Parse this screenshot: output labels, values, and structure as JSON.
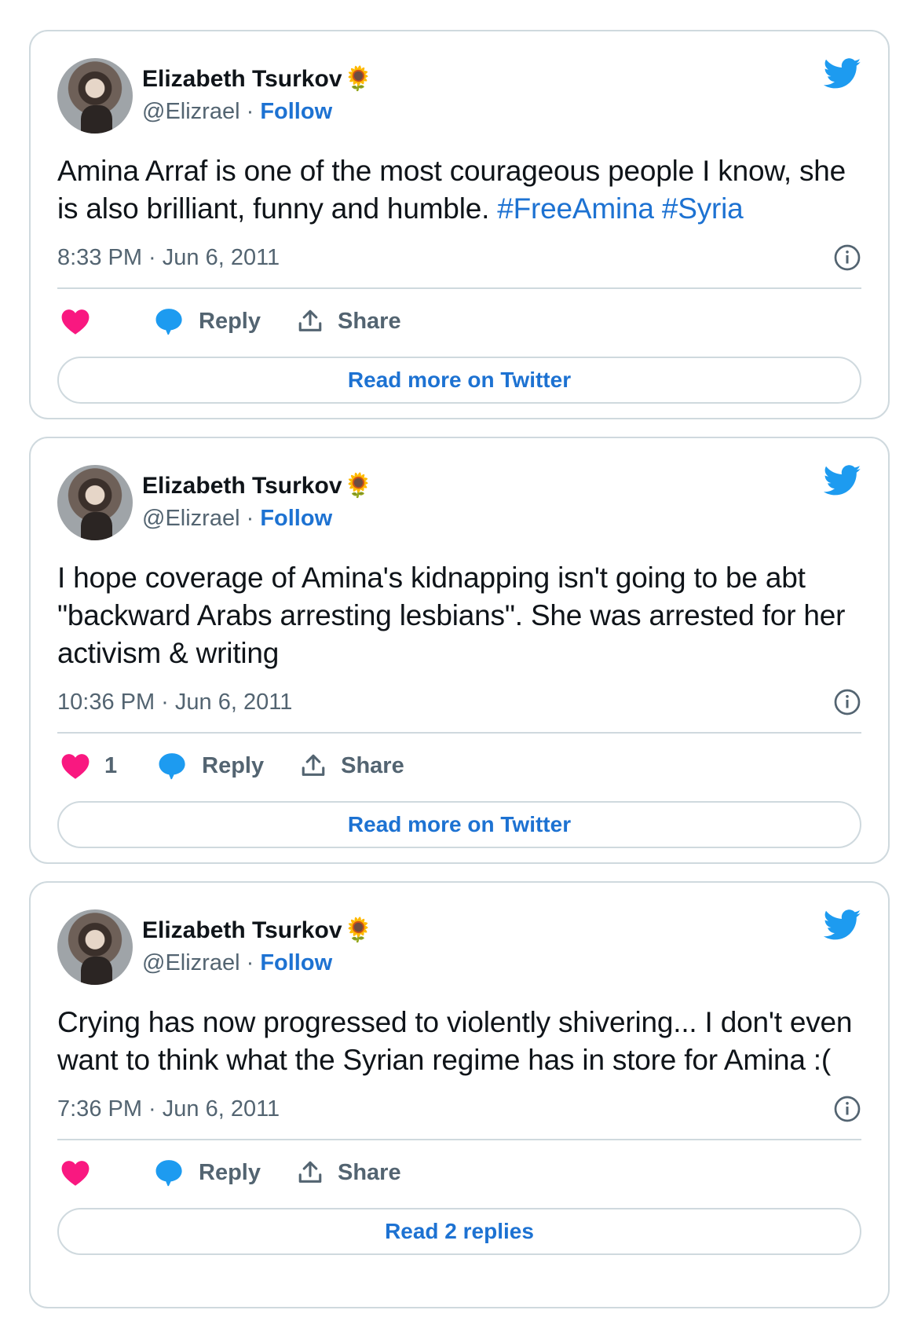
{
  "tweets": [
    {
      "author": {
        "name": "Elizabeth Tsurkov",
        "emoji": "🌻",
        "handle": "@Elizrael",
        "separator": " · ",
        "follow_label": "Follow"
      },
      "text": "Amina Arraf is one of the most courageous people I know, she is also brilliant, funny and humble. ",
      "hashtags": [
        "#FreeAmina",
        "#Syria"
      ],
      "timestamp": "8:33 PM · Jun 6, 2011",
      "likes": "",
      "reply_label": "Reply",
      "share_label": "Share",
      "cta_label": "Read more on Twitter"
    },
    {
      "author": {
        "name": "Elizabeth Tsurkov",
        "emoji": "🌻",
        "handle": "@Elizrael",
        "separator": " · ",
        "follow_label": "Follow"
      },
      "text": "I hope coverage of Amina's kidnapping isn't going to be abt \"backward Arabs arresting lesbians\". She was arrested for her activism & writing",
      "hashtags": [],
      "timestamp": "10:36 PM · Jun 6, 2011",
      "likes": "1",
      "reply_label": "Reply",
      "share_label": "Share",
      "cta_label": "Read more on Twitter"
    },
    {
      "author": {
        "name": "Elizabeth Tsurkov",
        "emoji": "🌻",
        "handle": "@Elizrael",
        "separator": " · ",
        "follow_label": "Follow"
      },
      "text": "Crying has now progressed to violently shivering... I don't even want to think what the Syrian regime has in store for Amina :(",
      "hashtags": [],
      "timestamp": "7:36 PM · Jun 6, 2011",
      "likes": "",
      "reply_label": "Reply",
      "share_label": "Share",
      "cta_label": "Read 2 replies"
    }
  ],
  "icons": {
    "brand": "twitter-bird-icon",
    "info": "info-icon",
    "like": "heart-icon",
    "reply": "reply-bubble-icon",
    "share": "share-upload-icon"
  },
  "colors": {
    "link": "#1d72d2",
    "bird": "#1d9bf0",
    "heart": "#f91880",
    "muted": "#536471",
    "border": "#cfd9de"
  }
}
